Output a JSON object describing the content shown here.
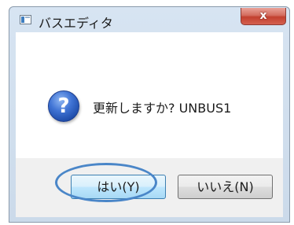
{
  "window": {
    "title": "バスエディタ",
    "icon": "app-window-icon",
    "close_label": "x"
  },
  "dialog": {
    "icon": "question-icon",
    "message": "更新しますか? UNBUS1"
  },
  "buttons": {
    "yes_label": "はい(Y)",
    "no_label": "いいえ(N)"
  },
  "colors": {
    "highlight_ring": "#4a86c8",
    "title_bar": "#cbdaea",
    "close_button": "#c2402f"
  }
}
